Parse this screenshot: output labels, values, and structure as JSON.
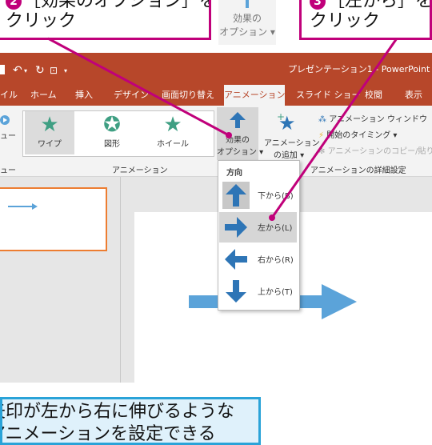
{
  "callouts": {
    "step2_number": "2",
    "step2_line1": "［効果のオプション］を",
    "step2_line2": "クリック",
    "step3_number": "3",
    "step3_line1": "［左から］を",
    "step3_line2": "クリック"
  },
  "floating_button": {
    "label_line1": "効果の",
    "label_line2": "オプション ▾"
  },
  "window": {
    "title": "プレゼンテーション1 - PowerPoint",
    "accent": "#b7472a"
  },
  "tabs": [
    "イル",
    "ホーム",
    "挿入",
    "デザイン",
    "画面切り替え",
    "アニメーション",
    "スライド ショー",
    "校閲",
    "表示"
  ],
  "active_tab": "アニメーション",
  "ribbon": {
    "preview_label_1": "ュー",
    "preview_label_2": "ュー",
    "gallery": [
      "ワイプ",
      "図形",
      "ホイール"
    ],
    "animation_group": "アニメーション",
    "effect_options_line1": "効果の",
    "effect_options_line2": "オプション ▾",
    "add_animation_line1": "アニメーション",
    "add_animation_line2": "の追加 ▾",
    "animation_pane": "アニメーション ウィンドウ",
    "timing": "開始のタイミング ▾",
    "painter": "アニメーションのコピー/貼り付け",
    "advanced_group": "アニメーションの詳細設定"
  },
  "menu": {
    "header": "方向",
    "items": [
      {
        "label": "下から(B)",
        "icon": "arrow-up-icon"
      },
      {
        "label": "左から(L)",
        "icon": "arrow-right-icon",
        "hover": true
      },
      {
        "label": "右から(R)",
        "icon": "arrow-left-icon"
      },
      {
        "label": "上から(T)",
        "icon": "arrow-down-icon"
      }
    ]
  },
  "colors": {
    "callout": "#c0007a",
    "note_border": "#2aa3d8",
    "arrow": "#5ba3d9",
    "thumb_border": "#ed7d31"
  },
  "note": {
    "line1": "矢印が左から右に伸びるような",
    "line2": "アニメーションを設定できる"
  }
}
